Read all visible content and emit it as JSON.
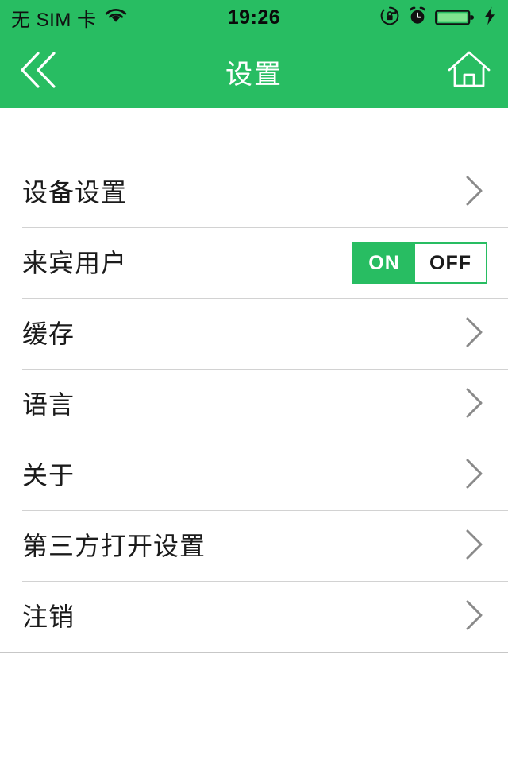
{
  "theme": {
    "accent": "#28bd62",
    "text": "#1b1b1b",
    "separator": "#d2d2d2",
    "separator_strong": "#c7c7c7",
    "background": "#ffffff"
  },
  "status_bar": {
    "carrier": "无 SIM 卡",
    "wifi_icon": "wifi-icon",
    "time": "19:26",
    "rotation_lock_icon": "rotation-lock-icon",
    "alarm_icon": "alarm-clock-icon",
    "battery_icon": "battery-icon",
    "charging_icon": "lightning-bolt-icon"
  },
  "nav_bar": {
    "back_icon": "double-chevron-left-icon",
    "title": "设置",
    "home_icon": "home-icon"
  },
  "settings_list": {
    "rows": [
      {
        "label": "设备设置",
        "accessory": "chevron",
        "name": "device-settings"
      },
      {
        "label": "来宾用户",
        "accessory": "segmented",
        "name": "guest-user"
      },
      {
        "label": "缓存",
        "accessory": "chevron",
        "name": "cache"
      },
      {
        "label": "语言",
        "accessory": "chevron",
        "name": "language"
      },
      {
        "label": "关于",
        "accessory": "chevron",
        "name": "about"
      },
      {
        "label": "第三方打开设置",
        "accessory": "chevron",
        "name": "third-party-open-settings"
      },
      {
        "label": "注销",
        "accessory": "chevron",
        "name": "logout"
      }
    ]
  },
  "guest_user_toggle": {
    "on_label": "ON",
    "off_label": "OFF",
    "selected": "ON"
  }
}
